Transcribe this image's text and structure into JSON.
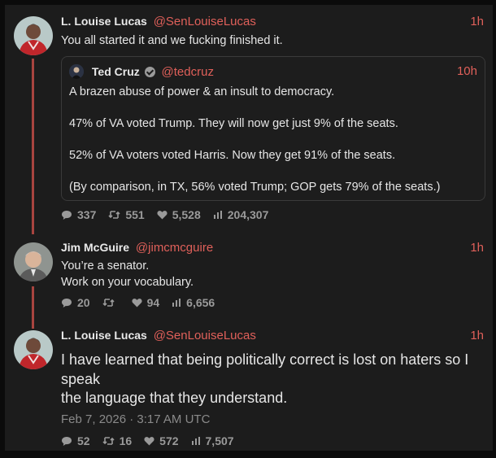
{
  "tweets": [
    {
      "name": "L. Louise Lucas",
      "handle": "@SenLouiseLucas",
      "time": "1h",
      "text": "You all started it and we fucking finished it.",
      "quote": {
        "name": "Ted Cruz",
        "handle": "@tedcruz",
        "time": "10h",
        "paragraphs": [
          "A brazen abuse of power & an insult to democracy.",
          "47% of VA voted Trump. They will now get just 9% of the seats.",
          "52% of VA voters voted Harris. Now they get 91% of the seats.",
          "(By comparison, in TX, 56% voted Trump; GOP gets 79% of the seats.)"
        ]
      },
      "stats": {
        "replies": "337",
        "retweets": "551",
        "likes": "5,528",
        "views": "204,307"
      }
    },
    {
      "name": "Jim McGuire",
      "handle": "@jimcmcguire",
      "time": "1h",
      "text_lines": [
        "You’re a senator.",
        "Work on your vocabulary."
      ],
      "stats": {
        "replies": "20",
        "retweets": "",
        "likes": "94",
        "views": "6,656"
      }
    },
    {
      "name": "L. Louise Lucas",
      "handle": "@SenLouiseLucas",
      "time": "1h",
      "text_lines": [
        "I have learned that being politically correct is lost on haters so I speak",
        "the language that they understand."
      ],
      "date": "Feb 7, 2026 · 3:17 AM UTC",
      "stats": {
        "replies": "52",
        "retweets": "16",
        "likes": "572",
        "views": "7,507"
      }
    }
  ],
  "colors": {
    "accent": "#e0605a",
    "thread_line": "#a8443f",
    "background": "#1c1c1c",
    "muted": "#9a9a9a"
  },
  "icons": [
    "comment-icon",
    "retweet-icon",
    "heart-icon",
    "views-chart-icon",
    "verified-badge-icon"
  ]
}
